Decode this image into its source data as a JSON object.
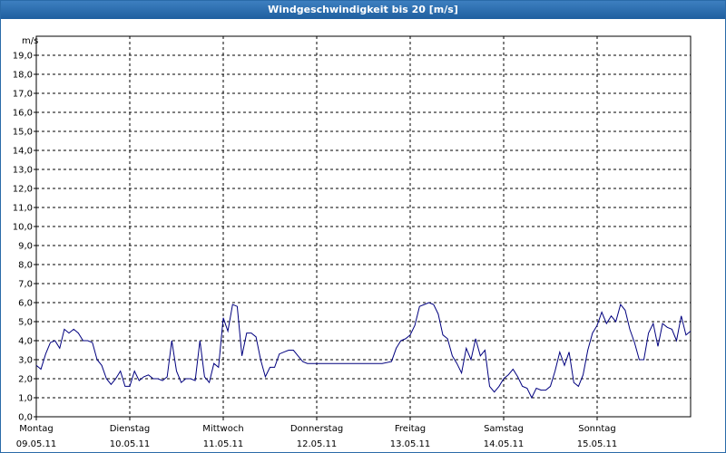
{
  "window": {
    "title": "Windgeschwindigkeit bis 20 [m/s]"
  },
  "chart_data": {
    "type": "line",
    "title": "Windgeschwindigkeit bis 20 [m/s]",
    "ylabel": "m/s",
    "xlabel": "",
    "ylim": [
      0,
      20
    ],
    "yticks": [
      "0,0",
      "1,0",
      "2,0",
      "3,0",
      "4,0",
      "5,0",
      "6,0",
      "7,0",
      "8,0",
      "9,0",
      "10,0",
      "11,0",
      "12,0",
      "13,0",
      "14,0",
      "15,0",
      "16,0",
      "17,0",
      "18,0",
      "19,0"
    ],
    "xlim_days": [
      0,
      7
    ],
    "days": [
      {
        "name": "Montag",
        "date": "09.05.11"
      },
      {
        "name": "Dienstag",
        "date": "10.05.11"
      },
      {
        "name": "Mittwoch",
        "date": "11.05.11"
      },
      {
        "name": "Donnerstag",
        "date": "12.05.11"
      },
      {
        "name": "Freitag",
        "date": "13.05.11"
      },
      {
        "name": "Samstag",
        "date": "14.05.11"
      },
      {
        "name": "Sonntag",
        "date": "15.05.11"
      }
    ],
    "grid": true,
    "colors": {
      "line": "#00007f",
      "grid": "#000000",
      "titlebar": "#2a6aa8"
    },
    "series": [
      {
        "x": [
          0.0,
          0.05,
          0.1,
          0.15,
          0.2,
          0.25,
          0.3,
          0.35,
          0.4,
          0.45,
          0.5,
          0.55,
          0.6,
          0.65,
          0.7,
          0.75,
          0.8,
          0.85,
          0.9,
          0.95,
          1.0,
          1.05,
          1.1,
          1.15,
          1.2,
          1.25,
          1.3,
          1.35,
          1.4,
          1.45,
          1.5,
          1.55,
          1.6,
          1.65,
          1.7,
          1.75,
          1.8,
          1.85,
          1.9,
          1.95,
          2.0,
          2.05,
          2.1,
          2.15,
          2.2,
          2.25,
          2.3,
          2.35,
          2.4,
          2.45,
          2.5,
          2.55,
          2.6,
          2.65,
          2.7,
          2.75,
          2.8,
          2.85,
          2.9,
          2.95,
          3.0,
          3.1,
          3.2,
          3.3,
          3.4,
          3.5,
          3.6,
          3.7,
          3.8,
          3.85,
          3.9,
          3.95,
          4.0,
          4.05,
          4.1,
          4.15,
          4.2,
          4.25,
          4.3,
          4.35,
          4.4,
          4.45,
          4.5,
          4.55,
          4.6,
          4.65,
          4.7,
          4.75,
          4.8,
          4.85,
          4.9,
          4.95,
          5.0,
          5.05,
          5.1,
          5.15,
          5.2,
          5.25,
          5.3,
          5.35,
          5.4,
          5.45,
          5.5,
          5.55,
          5.6,
          5.65,
          5.7,
          5.75,
          5.8,
          5.85,
          5.9,
          5.95,
          6.0,
          6.05,
          6.1,
          6.15,
          6.2,
          6.25,
          6.3,
          6.35,
          6.4,
          6.45,
          6.5,
          6.55,
          6.6,
          6.65,
          6.7,
          6.75,
          6.8,
          6.85,
          6.9,
          6.95,
          7.0
        ],
        "y": [
          2.7,
          2.5,
          3.3,
          3.9,
          4.0,
          3.6,
          4.6,
          4.4,
          4.6,
          4.4,
          4.0,
          4.0,
          3.9,
          3.0,
          2.7,
          2.0,
          1.7,
          2.0,
          2.4,
          1.6,
          1.6,
          2.4,
          1.9,
          2.1,
          2.2,
          2.0,
          2.0,
          1.9,
          2.1,
          4.0,
          2.4,
          1.8,
          2.0,
          2.0,
          1.9,
          4.0,
          2.1,
          1.8,
          2.8,
          2.6,
          5.2,
          4.5,
          5.9,
          5.8,
          3.2,
          4.4,
          4.4,
          4.2,
          3.0,
          2.1,
          2.6,
          2.6,
          3.3,
          3.4,
          3.5,
          3.5,
          3.2,
          2.9,
          2.8,
          2.8,
          2.8,
          2.8,
          2.8,
          2.8,
          2.8,
          2.8,
          2.8,
          2.8,
          2.9,
          3.6,
          4.0,
          4.1,
          4.3,
          4.8,
          5.8,
          5.9,
          6.0,
          5.9,
          5.4,
          4.3,
          4.1,
          3.2,
          2.8,
          2.3,
          3.6,
          3.0,
          4.1,
          3.2,
          3.5,
          1.6,
          1.3,
          1.6,
          2.0,
          2.2,
          2.5,
          2.1,
          1.6,
          1.5,
          1.0,
          1.5,
          1.4,
          1.4,
          1.6,
          2.4,
          3.4,
          2.7,
          3.4,
          1.8,
          1.6,
          2.2,
          3.5,
          4.4,
          4.8,
          5.5,
          4.9,
          5.3,
          5.0,
          5.9,
          5.6,
          4.6,
          3.9,
          3.0,
          3.0,
          4.4,
          4.9,
          3.7,
          4.9,
          4.7,
          4.6,
          4.0,
          5.3,
          4.3,
          4.5
        ]
      }
    ]
  }
}
